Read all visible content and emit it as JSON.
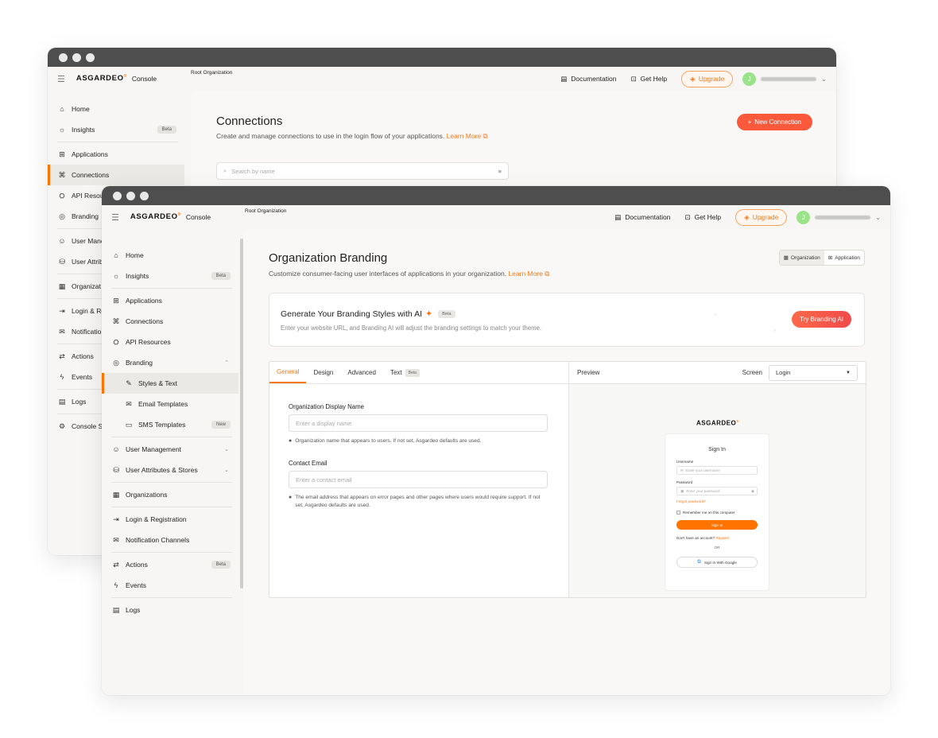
{
  "brand": {
    "logo_text": "ASGARDEO",
    "logo_mark": "®",
    "console": "Console",
    "accent": "#ff7300"
  },
  "topbar": {
    "root_org": "Root Organization",
    "documentation": "Documentation",
    "get_help": "Get Help",
    "upgrade": "Upgrade",
    "avatar_initial": "J"
  },
  "back_window": {
    "sidebar": [
      {
        "label": "Home",
        "icon": "home-icon"
      },
      {
        "label": "Insights",
        "icon": "bulb-icon",
        "badge": "Beta"
      },
      {
        "label": "Applications",
        "icon": "grid-icon"
      },
      {
        "label": "Connections",
        "icon": "connections-icon",
        "active": true
      },
      {
        "label": "API Resou",
        "icon": "api-icon"
      },
      {
        "label": "Branding",
        "icon": "palette-icon"
      },
      {
        "label": "User Manc",
        "icon": "user-icon"
      },
      {
        "label": "User Attrib",
        "icon": "attributes-icon"
      },
      {
        "label": "Organizat",
        "icon": "organization-icon"
      },
      {
        "label": "Login & Re",
        "icon": "login-icon"
      },
      {
        "label": "Notificatio",
        "icon": "notification-icon"
      },
      {
        "label": "Actions",
        "icon": "actions-icon"
      },
      {
        "label": "Events",
        "icon": "events-icon"
      },
      {
        "label": "Logs",
        "icon": "logs-icon"
      },
      {
        "label": "Console S",
        "icon": "settings-icon"
      }
    ],
    "title": "Connections",
    "subtitle": "Create and manage connections to use in the login flow of your applications.",
    "learn_more": "Learn More",
    "new_connection": "New Connection",
    "search_placeholder": "Search by name"
  },
  "front_window": {
    "sidebar": {
      "home": "Home",
      "insights": "Insights",
      "insights_badge": "Beta",
      "applications": "Applications",
      "connections": "Connections",
      "api_resources": "API Resources",
      "branding": "Branding",
      "styles_text": "Styles & Text",
      "email_templates": "Email Templates",
      "sms_templates": "SMS Templates",
      "sms_badge": "New",
      "user_management": "User Management",
      "user_attributes": "User Attributes & Stores",
      "organizations": "Organizations",
      "login_registration": "Login & Registration",
      "notification_channels": "Notification Channels",
      "actions": "Actions",
      "actions_badge": "Beta",
      "events": "Events",
      "logs": "Logs"
    },
    "title": "Organization Branding",
    "subtitle": "Customize consumer-facing user interfaces of applications in your organization.",
    "learn_more": "Learn More",
    "scope": {
      "organization": "Organization",
      "application": "Application",
      "selected": "Organization"
    },
    "ai": {
      "title": "Generate Your Branding Styles with AI",
      "badge": "Beta",
      "subtitle": "Enter your website URL, and Branding AI will adjust the branding settings to match your theme.",
      "button": "Try Branding AI"
    },
    "tabs": [
      {
        "label": "General",
        "active": true
      },
      {
        "label": "Design"
      },
      {
        "label": "Advanced"
      },
      {
        "label": "Text",
        "badge": "Beta"
      }
    ],
    "form": {
      "display_name_label": "Organization Display Name",
      "display_name_placeholder": "Enter a display name",
      "display_name_hint": "Organization name that appears to users. If not set, Asgardeo defaults are used.",
      "email_label": "Contact Email",
      "email_placeholder": "Enter a contact email",
      "email_hint": "The email address that appears on error pages and other pages where users would require support. If not set, Asgardeo defaults are used."
    },
    "preview": {
      "label": "Preview",
      "screen_label": "Screen",
      "screen_value": "Login",
      "sign_in_title": "Sign In",
      "username_label": "Username",
      "username_placeholder": "Enter your username",
      "password_label": "Password",
      "password_placeholder": "Enter your password",
      "forgot": "Forgot password?",
      "remember": "Remember me on this computer",
      "sign_in_button": "Sign In",
      "no_account": "Don't have an account?",
      "register": "Register",
      "or": "OR",
      "google": "Sign In With Google"
    }
  }
}
